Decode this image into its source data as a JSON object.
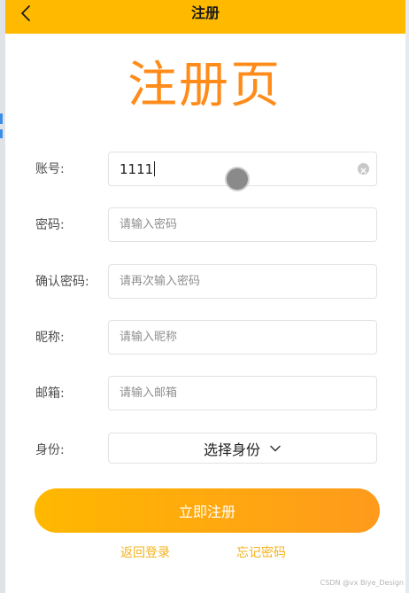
{
  "navbar": {
    "title": "注册",
    "back_icon": "chevron-left-icon"
  },
  "page_title": "注册页",
  "form": {
    "account": {
      "label": "账号:",
      "value": "1111"
    },
    "password": {
      "label": "密码:",
      "placeholder": "请输入密码"
    },
    "confirm_password": {
      "label": "确认密码:",
      "placeholder": "请再次输入密码"
    },
    "nickname": {
      "label": "昵称:",
      "placeholder": "请输入昵称"
    },
    "email": {
      "label": "邮箱:",
      "placeholder": "请输入邮箱"
    },
    "identity": {
      "label": "身份:",
      "selected": "选择身份"
    }
  },
  "submit_label": "立即注册",
  "links": {
    "back_to_login": "返回登录",
    "forgot_password": "忘记密码"
  },
  "watermark": "CSDN @vx Biye_Design",
  "colors": {
    "navbar_bg": "#ffba00",
    "title_color": "#ff8c1a",
    "link_color": "#f3b21e",
    "button_gradient_start": "#ffb800",
    "button_gradient_end": "#ff9a1c"
  }
}
